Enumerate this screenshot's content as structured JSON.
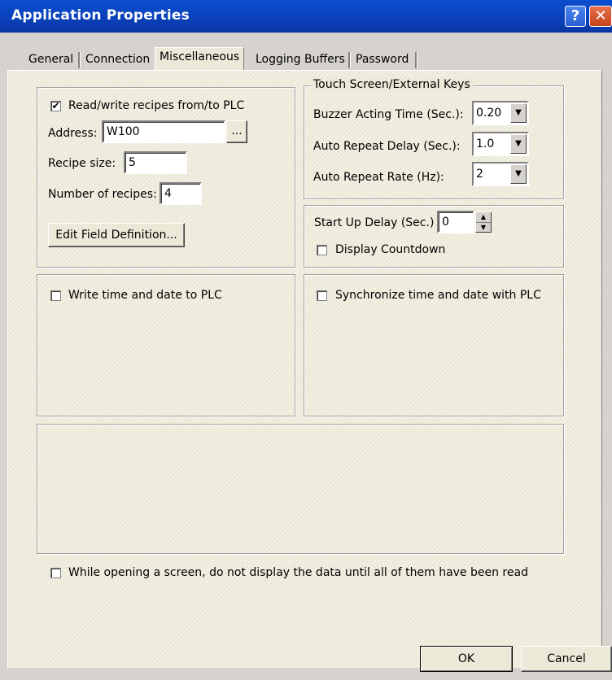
{
  "window": {
    "title": "Application Properties",
    "help_glyph": "?",
    "close_glyph": "✕"
  },
  "tabs": [
    {
      "label": "General"
    },
    {
      "label": "Connection"
    },
    {
      "label": "Miscellaneous"
    },
    {
      "label": "Logging Buffers"
    },
    {
      "label": "Password"
    }
  ],
  "active_tab": "Miscellaneous",
  "recipes": {
    "checkbox_label": "Read/write recipes from/to PLC",
    "checked": true,
    "address_label": "Address:",
    "address_value": "W100",
    "browse_label": "...",
    "size_label": "Recipe size:",
    "size_value": "5",
    "count_label": "Number of recipes:",
    "count_value": "4",
    "edit_button": "Edit Field Definition..."
  },
  "touch_screen": {
    "legend": "Touch Screen/External Keys",
    "buzzer_label": "Buzzer Acting Time (Sec.):",
    "buzzer_value": "0.20",
    "delay_label": "Auto Repeat Delay (Sec.):",
    "delay_value": "1.0",
    "rate_label": "Auto Repeat Rate (Hz):",
    "rate_value": "2"
  },
  "startup": {
    "label": "Start Up Delay (Sec.)",
    "value": "0",
    "countdown_label": "Display Countdown",
    "countdown_checked": false
  },
  "time_date": {
    "write_label": "Write time and date to PLC",
    "write_checked": false,
    "sync_label": "Synchronize time and date with PLC",
    "sync_checked": false
  },
  "display_option": {
    "label": "While opening a screen, do not display the data until all of them have been read",
    "checked": false
  },
  "buttons": {
    "ok": "OK",
    "cancel": "Cancel"
  },
  "glyphs": {
    "check": "✔",
    "down_arrow": "▼",
    "up_arrow": "▲"
  }
}
